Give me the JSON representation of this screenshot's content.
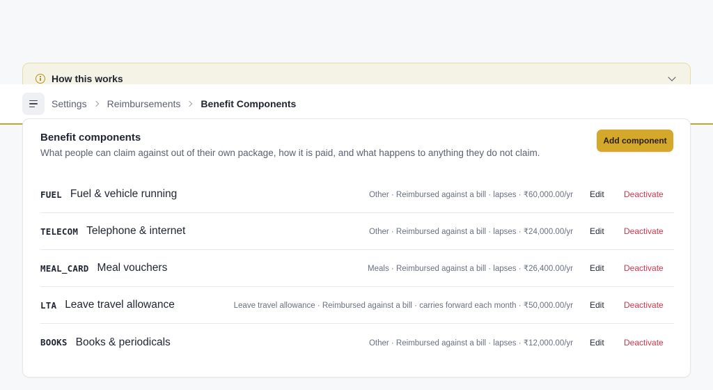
{
  "info_banner": {
    "title": "How this works"
  },
  "breadcrumb": {
    "items": [
      "Settings",
      "Reimbursements"
    ],
    "current": "Benefit Components"
  },
  "card": {
    "title": "Benefit components",
    "description": "What people can claim against out of their own package, how it is paid, and what happens to anything they do not claim.",
    "add_label": "Add component"
  },
  "components": [
    {
      "code": "FUEL",
      "name": "Fuel & vehicle running",
      "meta": "Other · Reimbursed against a bill · lapses · ₹60,000.00/yr",
      "edit": "Edit",
      "deactivate": "Deactivate"
    },
    {
      "code": "TELECOM",
      "name": "Telephone & internet",
      "meta": "Other · Reimbursed against a bill · lapses · ₹24,000.00/yr",
      "edit": "Edit",
      "deactivate": "Deactivate"
    },
    {
      "code": "MEAL_CARD",
      "name": "Meal vouchers",
      "meta": "Meals · Reimbursed against a bill · lapses · ₹26,400.00/yr",
      "edit": "Edit",
      "deactivate": "Deactivate"
    },
    {
      "code": "LTA",
      "name": "Leave travel allowance",
      "meta": "Leave travel allowance · Reimbursed against a bill · carries forward each month · ₹50,000.00/yr",
      "edit": "Edit",
      "deactivate": "Deactivate"
    },
    {
      "code": "BOOKS",
      "name": "Books & periodicals",
      "meta": "Other · Reimbursed against a bill · lapses · ₹12,000.00/yr",
      "edit": "Edit",
      "deactivate": "Deactivate"
    }
  ],
  "icons": {
    "info": "info-icon",
    "chevron": "chevron-down-icon",
    "menu": "menu-icon",
    "separator": "chevron-right-icon"
  },
  "colors": {
    "accent": "#d4a82a",
    "danger": "#d6334a",
    "banner_bg": "#f5f3e6"
  }
}
